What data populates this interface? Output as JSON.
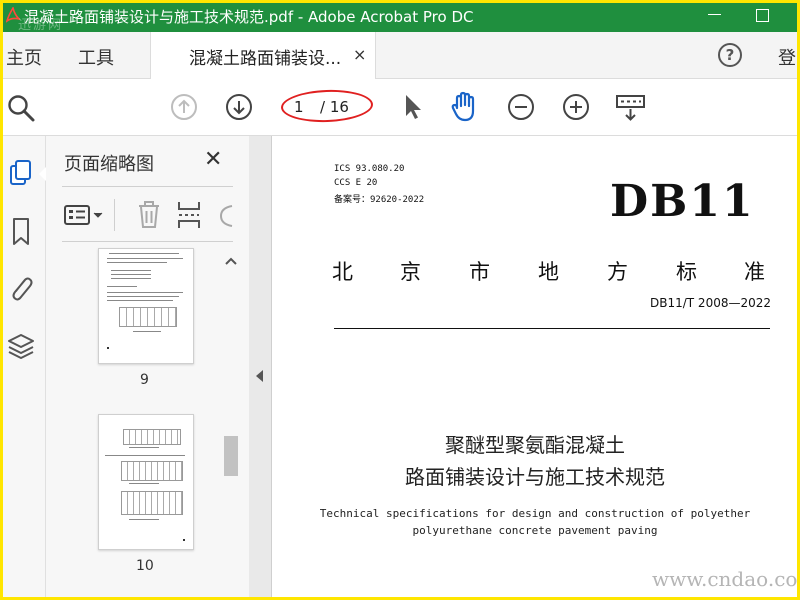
{
  "window": {
    "title": "混凝土路面铺装设计与施工技术规范.pdf - Adobe Acrobat Pro DC",
    "watermark": "迅游网"
  },
  "menu": {
    "home": "主页",
    "tools": "工具",
    "doc_tab": "混凝土路面铺装设...",
    "close_glyph": "×",
    "help_glyph": "?",
    "signin_partial": "登"
  },
  "toolbar": {
    "current_page": "1",
    "total_pages": "/ 16"
  },
  "thumbnails": {
    "title": "页面缩略图",
    "close_glyph": "✕",
    "items": [
      {
        "label": "9"
      },
      {
        "label": "10"
      }
    ]
  },
  "document": {
    "ics": "ICS  93.080.20",
    "ccs": "CCS  E 20",
    "record": "备案号：92620-2022",
    "logo": "DB11",
    "city_chars": [
      "北",
      "京",
      "市",
      "地",
      "方",
      "标",
      "准"
    ],
    "std_code": "DB11/T 2008—2022",
    "cn_title_line1": "聚醚型聚氨酯混凝土",
    "cn_title_line2": "路面铺装设计与施工技术规范",
    "en_title_line1": "Technical specifications for design and construction of polyether",
    "en_title_line2": "polyurethane concrete pavement paving"
  },
  "site_watermark": "www.cndao.com",
  "colors": {
    "titlebar": "#1f8f3e",
    "frame": "#ffe600",
    "accent_blue": "#1a64c8",
    "annotation_red": "#e02020"
  }
}
